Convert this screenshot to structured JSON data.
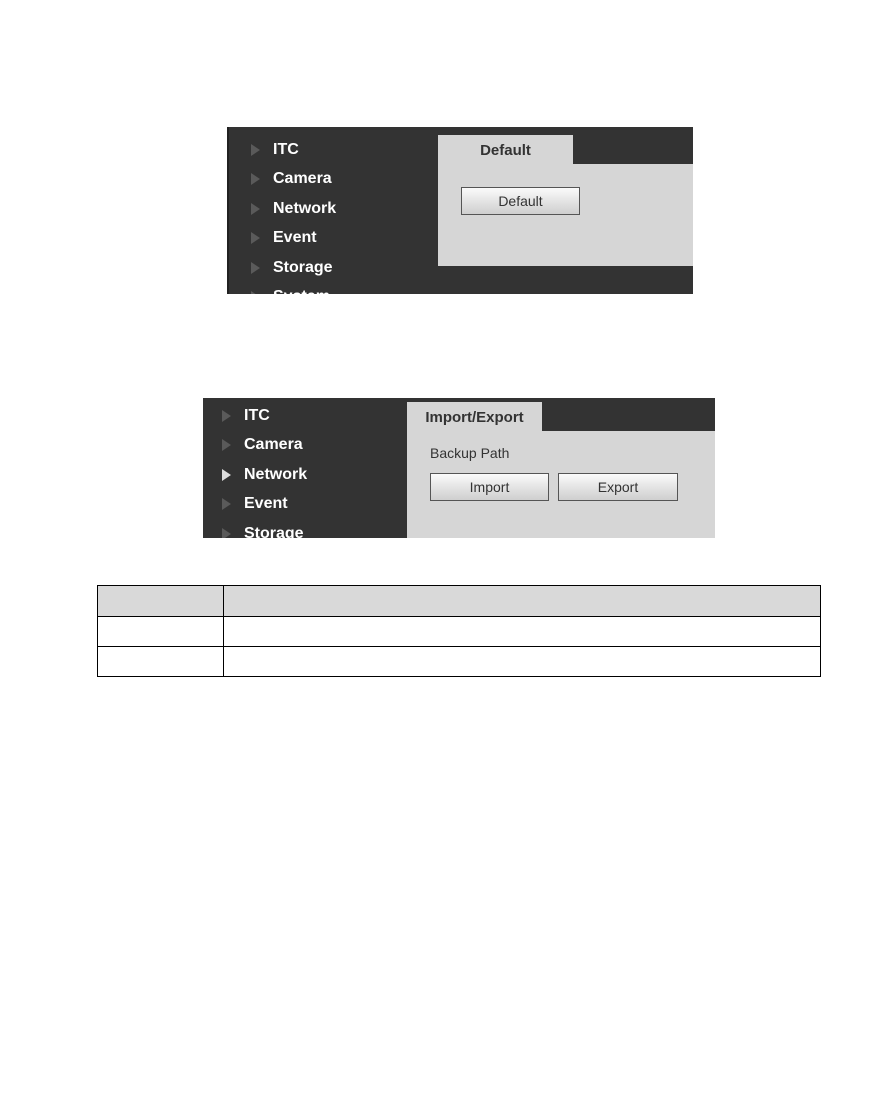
{
  "screenshot_default": {
    "menu": [
      {
        "label": "ITC",
        "active": false
      },
      {
        "label": "Camera",
        "active": false
      },
      {
        "label": "Network",
        "active": false
      },
      {
        "label": "Event",
        "active": false
      },
      {
        "label": "Storage",
        "active": false
      },
      {
        "label": "System",
        "active": false
      }
    ],
    "tab_label": "Default",
    "default_button": "Default"
  },
  "screenshot_import_export": {
    "menu": [
      {
        "label": "ITC",
        "active": false
      },
      {
        "label": "Camera",
        "active": false
      },
      {
        "label": "Network",
        "active": true
      },
      {
        "label": "Event",
        "active": false
      },
      {
        "label": "Storage",
        "active": false
      }
    ],
    "tab_label": "Import/Export",
    "backup_path_label": "Backup Path",
    "import_button": "Import",
    "export_button": "Export"
  },
  "param_table": {
    "headers": [
      "",
      ""
    ],
    "rows": [
      [
        "",
        ""
      ],
      [
        "",
        ""
      ]
    ]
  },
  "colors": {
    "menu_bg": "#333333",
    "panel_bg": "#d6d6d6",
    "table_header_bg": "#d9d9d9"
  }
}
